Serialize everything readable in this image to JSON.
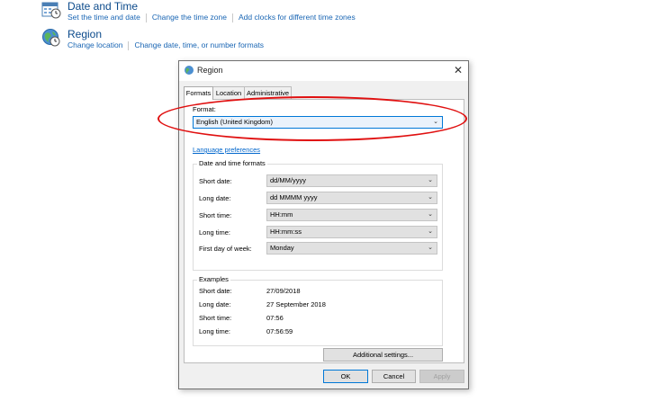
{
  "control_panel": {
    "date_time": {
      "title": "Date and Time",
      "links": [
        "Set the time and date",
        "Change the time zone",
        "Add clocks for different time zones"
      ]
    },
    "region": {
      "title": "Region",
      "links": [
        "Change location",
        "Change date, time, or number formats"
      ]
    }
  },
  "dialog": {
    "title": "Region",
    "close_glyph": "✕",
    "tabs": [
      "Formats",
      "Location",
      "Administrative"
    ],
    "format": {
      "label": "Format:",
      "value": "English (United Kingdom)"
    },
    "language_link": "Language preferences",
    "date_time_formats": {
      "title": "Date and time formats",
      "rows": [
        {
          "label": "Short date:",
          "value": "dd/MM/yyyy"
        },
        {
          "label": "Long date:",
          "value": "dd MMMM yyyy"
        },
        {
          "label": "Short time:",
          "value": "HH:mm"
        },
        {
          "label": "Long time:",
          "value": "HH:mm:ss"
        },
        {
          "label": "First day of week:",
          "value": "Monday"
        }
      ]
    },
    "examples": {
      "title": "Examples",
      "rows": [
        {
          "label": "Short date:",
          "value": "27/09/2018"
        },
        {
          "label": "Long date:",
          "value": "27 September 2018"
        },
        {
          "label": "Short time:",
          "value": "07:56"
        },
        {
          "label": "Long time:",
          "value": "07:56:59"
        }
      ]
    },
    "buttons": {
      "additional": "Additional settings...",
      "ok": "OK",
      "cancel": "Cancel",
      "apply": "Apply"
    },
    "chevron_glyph": "⌄"
  },
  "colors": {
    "highlight_ellipse": "#e01010",
    "link": "#1a66b4",
    "focus_border": "#0078d7"
  }
}
